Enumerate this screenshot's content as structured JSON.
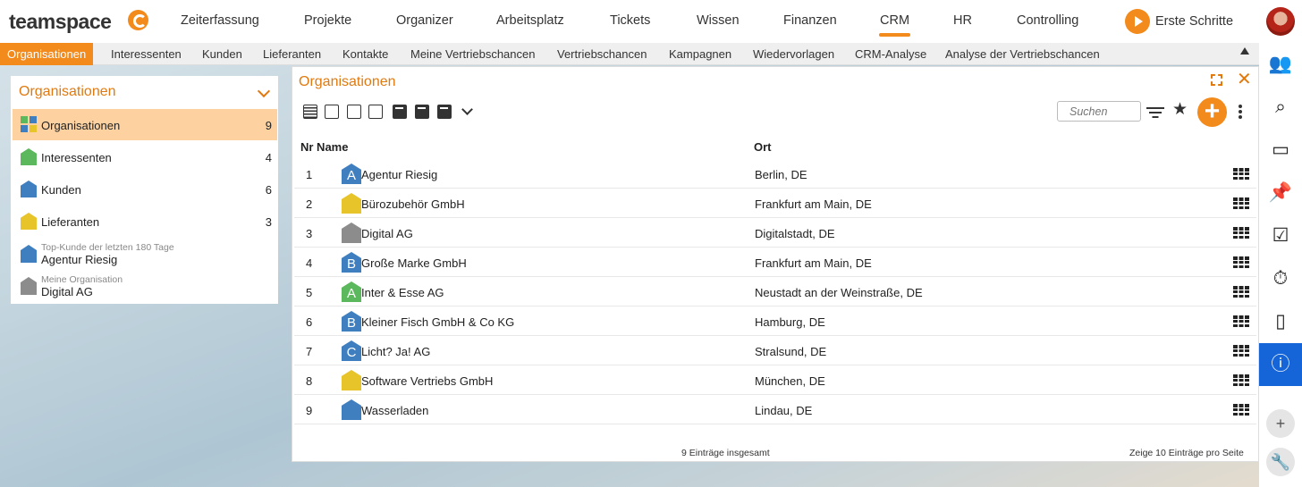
{
  "app": {
    "logo_text": "teamspace",
    "brand_color": "#f28a1c",
    "accent_blue": "#1565d8"
  },
  "topnav": {
    "items": [
      "Zeiterfassung",
      "Projekte",
      "Organizer",
      "Arbeitsplatz",
      "Tickets",
      "Wissen",
      "Finanzen",
      "CRM",
      "HR",
      "Controlling"
    ],
    "active": "CRM",
    "first_steps_label": "Erste Schritte"
  },
  "subnav": {
    "items": [
      "Organisationen",
      "Interessenten",
      "Kunden",
      "Lieferanten",
      "Kontakte",
      "Meine Vertriebschancen",
      "Vertriebschancen",
      "Kampagnen",
      "Wiedervorlagen",
      "CRM-Analyse",
      "Analyse der Vertriebschancen"
    ],
    "active": "Organisationen"
  },
  "leftpanel": {
    "title": "Organisationen",
    "rows": [
      {
        "label": "Organisationen",
        "count": "9",
        "icon": "grid-icon"
      },
      {
        "label": "Interessenten",
        "count": "4",
        "icon": "house-green-icon"
      },
      {
        "label": "Kunden",
        "count": "6",
        "icon": "house-blue-icon"
      },
      {
        "label": "Lieferanten",
        "count": "3",
        "icon": "house-yellow-icon"
      }
    ],
    "top_customer": {
      "caption": "Top-Kunde der letzten 180 Tage",
      "value": "Agentur Riesig"
    },
    "my_org": {
      "caption": "Meine Organisation",
      "value": "Digital AG"
    }
  },
  "main": {
    "title": "Organisationen",
    "search_placeholder": "Suchen",
    "columns": {
      "nr_name": "Nr Name",
      "ort": "Ort"
    },
    "rows": [
      {
        "nr": "1",
        "letter": "A",
        "color": "#3f7fbf",
        "name": "Agentur Riesig",
        "ort": "Berlin, DE"
      },
      {
        "nr": "2",
        "letter": "",
        "color": "#e6c42a",
        "name": "Bürozubehör GmbH",
        "ort": "Frankfurt am Main, DE"
      },
      {
        "nr": "3",
        "letter": "",
        "color": "#8c8c8c",
        "name": "Digital AG",
        "ort": "Digitalstadt, DE"
      },
      {
        "nr": "4",
        "letter": "B",
        "color": "#3f7fbf",
        "name": "Große Marke GmbH",
        "ort": "Frankfurt am Main, DE"
      },
      {
        "nr": "5",
        "letter": "A",
        "color": "#5cb85c",
        "name": "Inter & Esse AG",
        "ort": "Neustadt an der Weinstraße, DE"
      },
      {
        "nr": "6",
        "letter": "B",
        "color": "#3f7fbf",
        "name": "Kleiner Fisch GmbH & Co KG",
        "ort": "Hamburg, DE"
      },
      {
        "nr": "7",
        "letter": "C",
        "color": "#3f7fbf",
        "name": "Licht? Ja! AG",
        "ort": "Stralsund, DE"
      },
      {
        "nr": "8",
        "letter": "",
        "color": "#e6c42a",
        "name": "Software Vertriebs GmbH",
        "ort": "München, DE"
      },
      {
        "nr": "9",
        "letter": "",
        "color": "#3f7fbf",
        "name": "Wasserladen",
        "ort": "Lindau, DE"
      }
    ],
    "footer_total": "9 Einträge insgesamt",
    "footer_paging": "Zeige  10  Einträge pro Seite"
  },
  "rightbar": {
    "items": [
      "contacts-icon",
      "search-icon",
      "inbox-icon",
      "pin-icon",
      "tasks-icon",
      "timer-icon",
      "mobile-icon",
      "info-icon"
    ],
    "active": "info-icon",
    "bottom": [
      "add-circle-icon",
      "wrench-icon"
    ]
  }
}
